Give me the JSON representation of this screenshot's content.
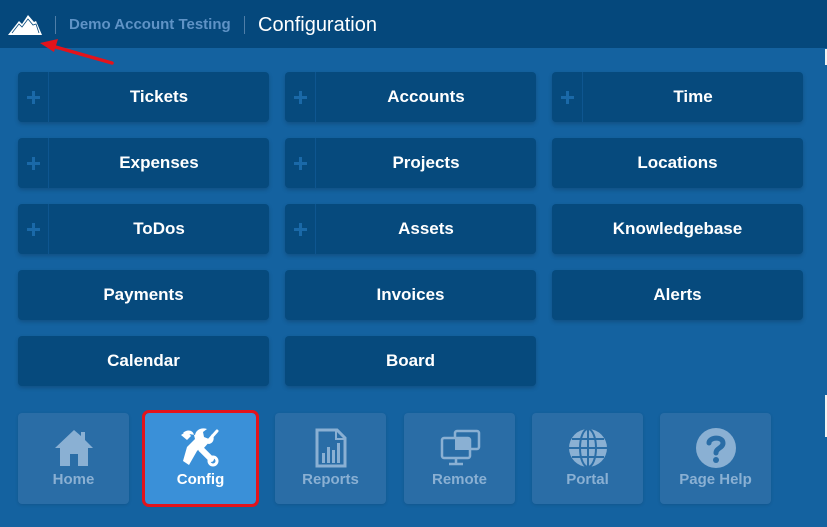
{
  "header": {
    "logo_icon": "mountain-logo-icon",
    "account_name": "Demo Account Testing",
    "page_title": "Configuration"
  },
  "tiles": [
    {
      "label": "Tickets",
      "has_plus": true
    },
    {
      "label": "Accounts",
      "has_plus": true
    },
    {
      "label": "Time",
      "has_plus": true
    },
    {
      "label": "Expenses",
      "has_plus": true
    },
    {
      "label": "Projects",
      "has_plus": true
    },
    {
      "label": "Locations",
      "has_plus": false
    },
    {
      "label": "ToDos",
      "has_plus": true
    },
    {
      "label": "Assets",
      "has_plus": true
    },
    {
      "label": "Knowledgebase",
      "has_plus": false
    },
    {
      "label": "Payments",
      "has_plus": false
    },
    {
      "label": "Invoices",
      "has_plus": false
    },
    {
      "label": "Alerts",
      "has_plus": false
    },
    {
      "label": "Calendar",
      "has_plus": false
    },
    {
      "label": "Board",
      "has_plus": false
    }
  ],
  "nav": [
    {
      "label": "Home",
      "icon": "home-icon",
      "active": false
    },
    {
      "label": "Config",
      "icon": "tools-icon",
      "active": true
    },
    {
      "label": "Reports",
      "icon": "report-icon",
      "active": false
    },
    {
      "label": "Remote",
      "icon": "remote-monitors-icon",
      "active": false
    },
    {
      "label": "Portal",
      "icon": "globe-icon",
      "active": false
    },
    {
      "label": "Page Help",
      "icon": "help-icon",
      "active": false
    }
  ],
  "colors": {
    "header_bg": "#05487c",
    "page_bg": "#1462a0",
    "tile_bg": "#064a7d",
    "nav_bg": "#2a6da6",
    "nav_active_bg": "#3a90d8",
    "highlight_outline": "#e3131b",
    "annotation_arrow": "#e3131b"
  }
}
